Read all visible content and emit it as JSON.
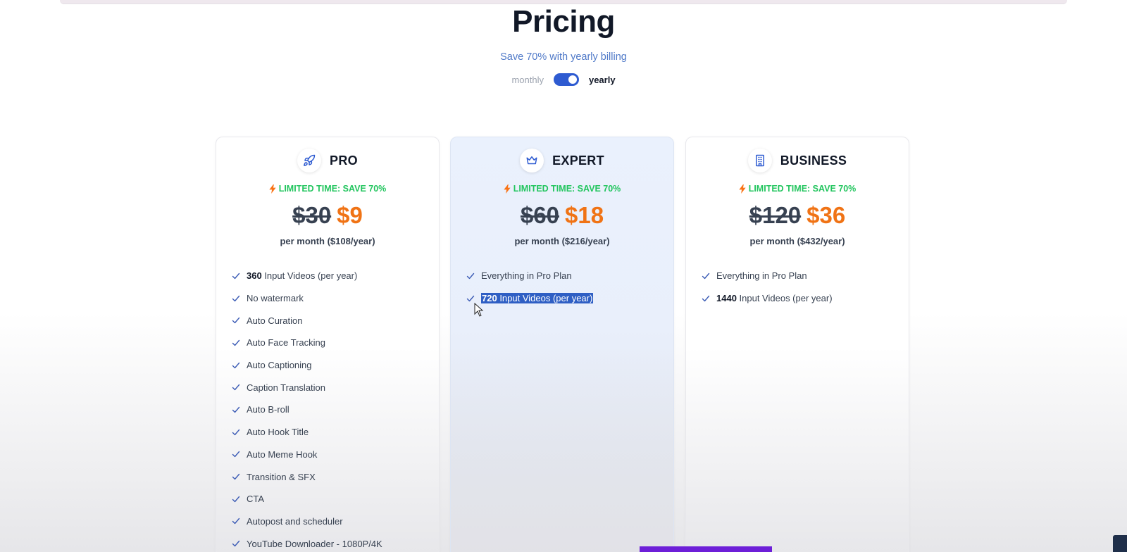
{
  "header": {
    "title": "Pricing",
    "subtitle": "Save 70% with yearly billing",
    "toggle_monthly": "monthly",
    "toggle_yearly": "yearly",
    "billing_selected": "yearly"
  },
  "colors": {
    "accent_blue": "#2e5bd1",
    "sale_green": "#22c55e",
    "price_orange": "#f07315",
    "subtitle_blue": "#4f79c8"
  },
  "plans": [
    {
      "name": "PRO",
      "icon": "rocket-icon",
      "limited": "LIMITED TIME: SAVE 70%",
      "old_price": "$30",
      "new_price": "$9",
      "per_month": "per month ($108/year)",
      "features": [
        {
          "bold": "360",
          "text": " Input Videos (per year)"
        },
        {
          "bold": "",
          "text": "No watermark"
        },
        {
          "bold": "",
          "text": "Auto Curation"
        },
        {
          "bold": "",
          "text": "Auto Face Tracking"
        },
        {
          "bold": "",
          "text": "Auto Captioning"
        },
        {
          "bold": "",
          "text": "Caption Translation"
        },
        {
          "bold": "",
          "text": "Auto B-roll"
        },
        {
          "bold": "",
          "text": "Auto Hook Title"
        },
        {
          "bold": "",
          "text": "Auto Meme Hook"
        },
        {
          "bold": "",
          "text": "Transition & SFX"
        },
        {
          "bold": "",
          "text": "CTA"
        },
        {
          "bold": "",
          "text": "Autopost and scheduler"
        },
        {
          "bold": "",
          "text": "YouTube Downloader - 1080P/4K"
        }
      ]
    },
    {
      "name": "EXPERT",
      "icon": "crown-icon",
      "limited": "LIMITED TIME: SAVE 70%",
      "old_price": "$60",
      "new_price": "$18",
      "per_month": "per month ($216/year)",
      "features": [
        {
          "bold": "",
          "text": "Everything in Pro Plan"
        },
        {
          "bold": "720",
          "text": " Input Videos (per year)",
          "selected": true
        }
      ]
    },
    {
      "name": "BUSINESS",
      "icon": "building-icon",
      "limited": "LIMITED TIME: SAVE 70%",
      "old_price": "$120",
      "new_price": "$36",
      "per_month": "per month ($432/year)",
      "features": [
        {
          "bold": "",
          "text": "Everything in Pro Plan"
        },
        {
          "bold": "1440",
          "text": " Input Videos (per year)"
        }
      ]
    }
  ]
}
